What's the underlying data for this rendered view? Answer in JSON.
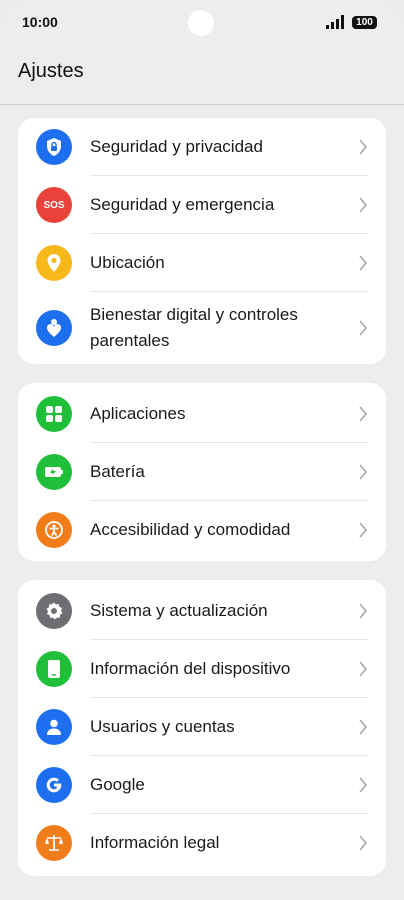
{
  "status_bar": {
    "time": "10:00",
    "battery": "100"
  },
  "header": {
    "title": "Ajustes"
  },
  "groups": [
    {
      "items": [
        {
          "label": "Seguridad y privacidad",
          "icon": "shield-lock-icon",
          "color": "#1e6ff0"
        },
        {
          "label": "Seguridad y emergencia",
          "icon": "sos-icon",
          "color": "#e8423a",
          "icon_text": "SOS"
        },
        {
          "label": "Ubicación",
          "icon": "location-pin-icon",
          "color": "#f6b81b"
        },
        {
          "label": "Bienestar digital y controles parentales",
          "icon": "wellbeing-icon",
          "color": "#1e6ff0"
        }
      ]
    },
    {
      "items": [
        {
          "label": "Aplicaciones",
          "icon": "apps-grid-icon",
          "color": "#1fbf3a"
        },
        {
          "label": "Batería",
          "icon": "battery-icon",
          "color": "#1fbf3a"
        },
        {
          "label": "Accesibilidad y comodidad",
          "icon": "accessibility-icon",
          "color": "#f07d1a"
        }
      ]
    },
    {
      "items": [
        {
          "label": "Sistema y actualización",
          "icon": "gear-icon",
          "color": "#6e6e72"
        },
        {
          "label": "Información del dispositivo",
          "icon": "phone-icon",
          "color": "#1fbf3a"
        },
        {
          "label": "Usuarios y cuentas",
          "icon": "user-icon",
          "color": "#1e6ff0"
        },
        {
          "label": "Google",
          "icon": "google-icon",
          "color": "#1e6ff0"
        },
        {
          "label": "Información legal",
          "icon": "scales-icon",
          "color": "#f07d1a"
        }
      ]
    }
  ]
}
